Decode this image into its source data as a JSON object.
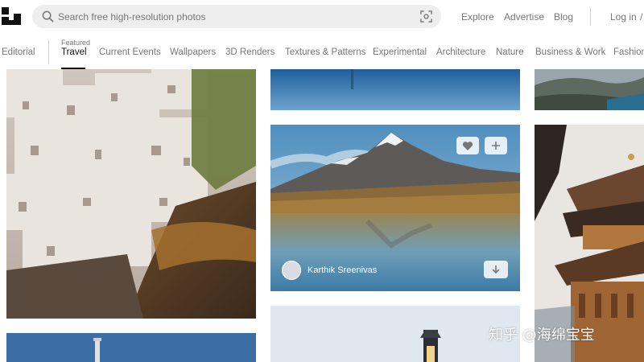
{
  "header": {
    "search": {
      "placeholder": "Search free high-resolution photos"
    },
    "nav": {
      "explore": "Explore",
      "advertise": "Advertise",
      "blog": "Blog",
      "login": "Log in",
      "slash": "/"
    }
  },
  "topics": {
    "editorial": "Editorial",
    "featured_label": "Featured",
    "items": [
      "Travel",
      "Current Events",
      "Wallpapers",
      "3D Renders",
      "Textures & Patterns",
      "Experimental",
      "Architecture",
      "Nature",
      "Business & Work",
      "Fashion"
    ],
    "active": "Travel"
  },
  "photos": {
    "lake": {
      "author": "Karthik Sreenivas"
    }
  },
  "icons": {
    "logo": "unsplash-logo-icon",
    "search": "search-icon",
    "visual_search": "visual-search-icon",
    "like": "heart-icon",
    "add": "plus-icon",
    "download": "download-arrow-icon"
  },
  "watermark": "知乎 @海绵宝宝"
}
